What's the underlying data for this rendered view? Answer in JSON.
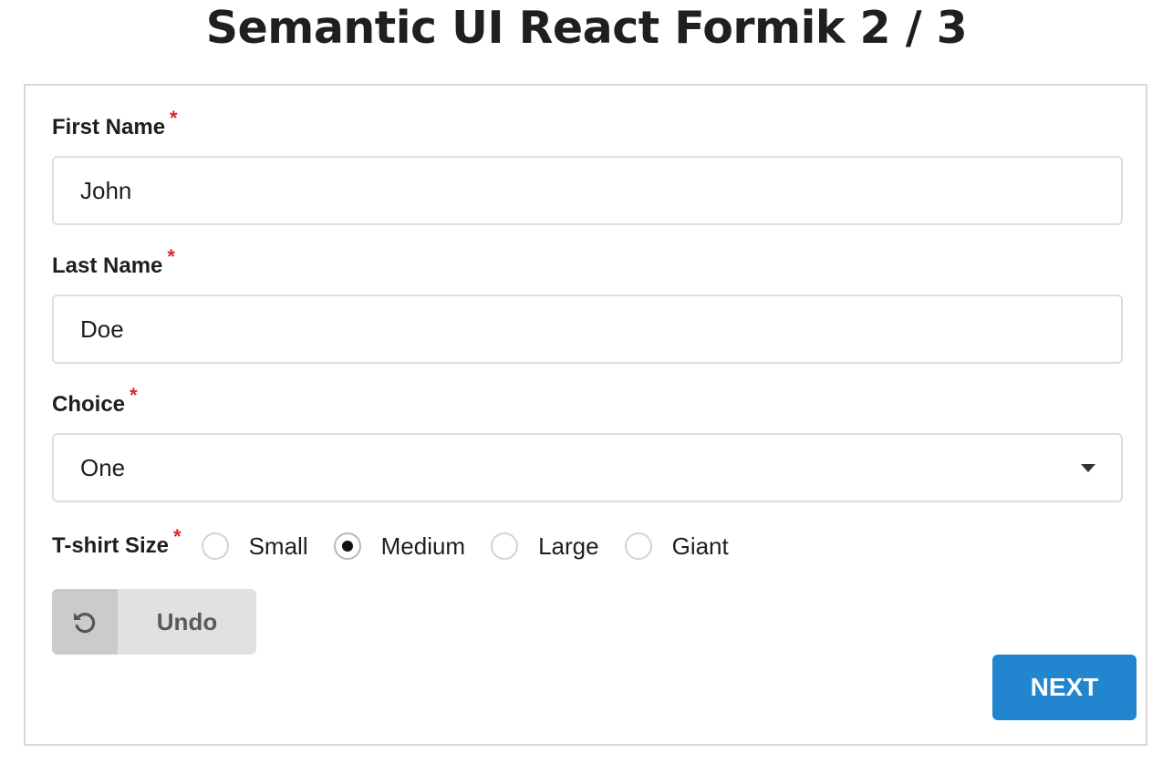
{
  "page": {
    "title": "Semantic UI React Formik 2 / 3"
  },
  "form": {
    "required_marker": "*",
    "first_name": {
      "label": "First Name",
      "value": "John"
    },
    "last_name": {
      "label": "Last Name",
      "value": "Doe"
    },
    "choice": {
      "label": "Choice",
      "selected": "One"
    },
    "tshirt_size": {
      "label": "T-shirt Size",
      "options": [
        "Small",
        "Medium",
        "Large",
        "Giant"
      ],
      "selected": "Medium"
    },
    "undo_button": {
      "label": "Undo",
      "icon": "undo-icon"
    },
    "next_button": {
      "label": "NEXT"
    }
  },
  "colors": {
    "required": "#db2828",
    "primary": "#2185d0",
    "undo_bg": "#e0e1e2",
    "undo_icon_bg": "#cacbcd"
  }
}
